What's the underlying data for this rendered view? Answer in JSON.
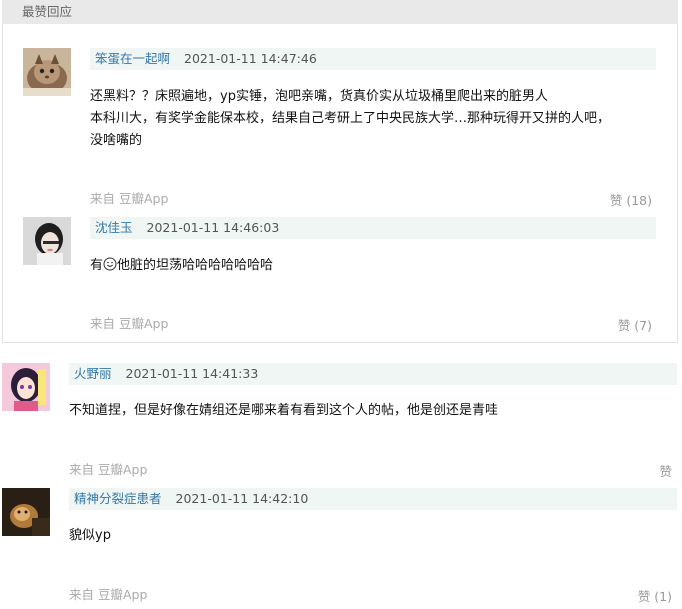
{
  "section_title": "最赞回应",
  "comments": [
    {
      "author": "笨蛋在一起啊",
      "time": "2021-01-11 14:47:46",
      "lines": [
        "还黑料？？床照遍地，yp实锤，泡吧亲嘴，货真价实从垃圾桶里爬出来的脏男人",
        "本科川大，有奖学金能保本校，结果自己考研上了中央民族大学…那种玩得开又拼的人吧，",
        "没啥嘴的"
      ],
      "source": "来自",
      "app": "豆瓣App",
      "vote": "赞 (18)",
      "avatar_icon": "cat-avatar-icon"
    },
    {
      "author": "沈佳玉",
      "time": "2021-01-11 14:46:03",
      "text_before": "有",
      "text_after": "他脏的坦荡哈哈哈哈哈哈哈",
      "emoji_icon": "smile-emoji-icon",
      "source": "来自",
      "app": "豆瓣App",
      "vote": "赞 (7)",
      "avatar_icon": "girl-photo-avatar-icon"
    },
    {
      "author": "火野丽",
      "time": "2021-01-11 14:41:33",
      "text": "不知道捏，但是好像在婧组还是哪来着有看到这个人的帖，他是创还是青哇",
      "source": "来自",
      "app": "豆瓣App",
      "vote": "赞",
      "avatar_icon": "anime-girl-avatar-icon"
    },
    {
      "author": "精神分裂症患者",
      "time": "2021-01-11 14:42:10",
      "text": "貌似yp",
      "source": "来自",
      "app": "豆瓣App",
      "vote": "赞 (1)",
      "avatar_icon": "dark-photo-avatar-icon"
    }
  ],
  "colors": {
    "author_link": "#3377aa",
    "meta_bar_bg": "#f0f6f3",
    "header_bg": "#e9e9e9"
  }
}
